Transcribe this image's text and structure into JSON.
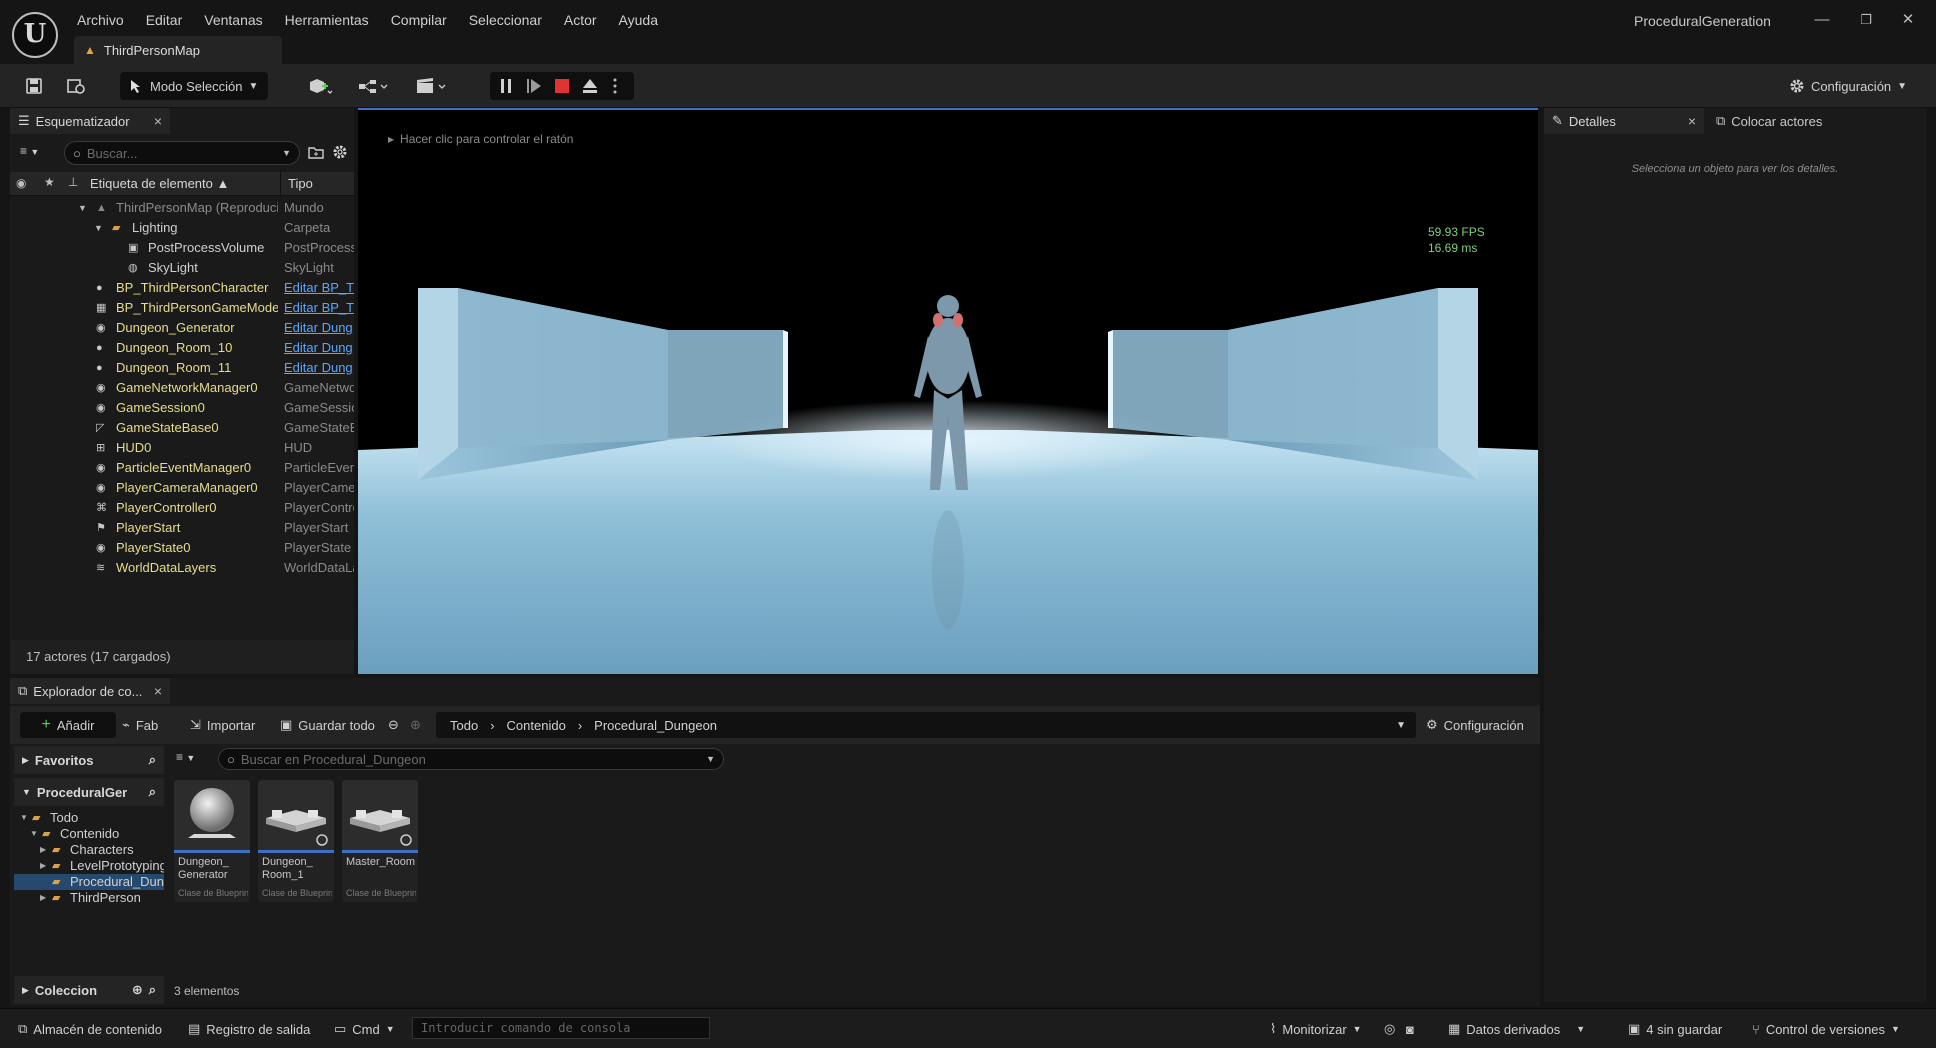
{
  "app": {
    "logo": "U",
    "project_name": "ProceduralGeneration",
    "map_tab": "ThirdPersonMap",
    "window_controls": {
      "minimize": "—",
      "restore": "❐",
      "close": "✕"
    }
  },
  "menu": [
    "Archivo",
    "Editar",
    "Ventanas",
    "Herramientas",
    "Compilar",
    "Seleccionar",
    "Actor",
    "Ayuda"
  ],
  "toolbar": {
    "mode_label": "Modo Selección",
    "settings_label": "Configuración"
  },
  "outliner": {
    "tab_label": "Esquematizador",
    "search_placeholder": "Buscar...",
    "col_label": "Etiqueta de elemento ▲",
    "col_type": "Tipo",
    "rows": [
      {
        "label": "ThirdPersonMap (Reproducir)",
        "type": "Mundo",
        "depth": 0,
        "icon": "map-icon",
        "arrow": "▼",
        "dim": true
      },
      {
        "label": "Lighting",
        "type": "Carpeta",
        "depth": 1,
        "icon": "folder-icon",
        "arrow": "▼"
      },
      {
        "label": "PostProcessVolume",
        "type": "PostProcessVolume",
        "depth": 2,
        "icon": "volume-icon"
      },
      {
        "label": "SkyLight",
        "type": "SkyLight",
        "depth": 2,
        "icon": "skylight-icon"
      },
      {
        "label": "BP_ThirdPersonCharacter",
        "type": "Editar BP_T",
        "depth": 0,
        "icon": "pawn-icon",
        "link": true
      },
      {
        "label": "BP_ThirdPersonGameMode",
        "type": "Editar BP_T",
        "depth": 0,
        "icon": "gamemode-icon",
        "link": true
      },
      {
        "label": "Dungeon_Generator",
        "type": "Editar Dung",
        "depth": 0,
        "icon": "actor-icon",
        "link": true
      },
      {
        "label": "Dungeon_Room_10",
        "type": "Editar Dung",
        "depth": 0,
        "icon": "pawn-icon",
        "link": true
      },
      {
        "label": "Dungeon_Room_11",
        "type": "Editar Dung",
        "depth": 0,
        "icon": "pawn-icon",
        "link": true
      },
      {
        "label": "GameNetworkManager0",
        "type": "GameNetworkManager",
        "depth": 0,
        "icon": "actor-icon"
      },
      {
        "label": "GameSession0",
        "type": "GameSession",
        "depth": 0,
        "icon": "actor-icon"
      },
      {
        "label": "GameStateBase0",
        "type": "GameStateBase",
        "depth": 0,
        "icon": "chart-icon"
      },
      {
        "label": "HUD0",
        "type": "HUD",
        "depth": 0,
        "icon": "hud-icon"
      },
      {
        "label": "ParticleEventManager0",
        "type": "ParticleEventManager",
        "depth": 0,
        "icon": "actor-icon"
      },
      {
        "label": "PlayerCameraManager0",
        "type": "PlayerCameraManager",
        "depth": 0,
        "icon": "actor-icon"
      },
      {
        "label": "PlayerController0",
        "type": "PlayerController",
        "depth": 0,
        "icon": "gamepad-icon"
      },
      {
        "label": "PlayerStart",
        "type": "PlayerStart",
        "depth": 0,
        "icon": "flag-icon"
      },
      {
        "label": "PlayerState0",
        "type": "PlayerState",
        "depth": 0,
        "icon": "actor-icon"
      },
      {
        "label": "WorldDataLayers",
        "type": "WorldDataLayers",
        "depth": 0,
        "icon": "layers-icon"
      }
    ],
    "actor_count": "17 actores (17 cargados)"
  },
  "viewport": {
    "hint": "Hacer clic para controlar el ratón",
    "fps": "59.93 FPS",
    "ms": "16.69 ms"
  },
  "details": {
    "tab_label": "Detalles",
    "place_tab_label": "Colocar actores",
    "empty_message": "Selecciona un objeto para ver los detalles."
  },
  "content_browser": {
    "tab_label": "Explorador de co...",
    "add_label": "Añadir",
    "fab_label": "Fab",
    "import_label": "Importar",
    "save_all_label": "Guardar todo",
    "path": [
      "Todo",
      "Contenido",
      "Procedural_Dungeon"
    ],
    "settings_label": "Configuración",
    "favorites_label": "Favoritos",
    "project_label": "ProceduralGer",
    "collections_label": "Coleccion",
    "tree": [
      {
        "label": "Todo",
        "depth": 0,
        "arrow": "▼"
      },
      {
        "label": "Contenido",
        "depth": 1,
        "arrow": "▼"
      },
      {
        "label": "Characters",
        "depth": 2,
        "arrow": "▶"
      },
      {
        "label": "LevelPrototyping",
        "depth": 2,
        "arrow": "▶"
      },
      {
        "label": "Procedural_Dungeon",
        "depth": 2,
        "arrow": "",
        "selected": true
      },
      {
        "label": "ThirdPerson",
        "depth": 2,
        "arrow": "▶"
      }
    ],
    "search_placeholder": "Buscar en Procedural_Dungeon",
    "assets": [
      {
        "name": "Dungeon_ Generator",
        "kind": "Clase de Blueprint",
        "thumb": "sphere"
      },
      {
        "name": "Dungeon_ Room_1",
        "kind": "Clase de Blueprint",
        "thumb": "room"
      },
      {
        "name": "Master_Room",
        "kind": "Clase de Blueprint",
        "thumb": "room"
      }
    ],
    "item_count": "3 elementos"
  },
  "statusbar": {
    "content_drawer": "Almacén de contenido",
    "output_log": "Registro de salida",
    "cmd": "Cmd",
    "console_placeholder": "Introducir comando de consola",
    "monitor": "Monitorizar",
    "derived_data": "Datos derivados",
    "unsaved": "4 sin guardar",
    "source_control": "Control de versiones"
  }
}
